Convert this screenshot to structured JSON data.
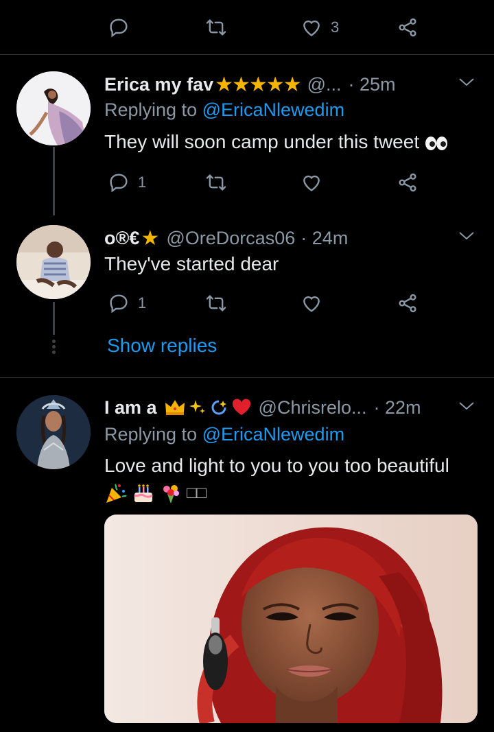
{
  "colors": {
    "background": "#000000",
    "accent": "#1d9bf0",
    "muted": "#8b98a5",
    "text": "#e7e9ea",
    "divider": "#2f3336"
  },
  "top_actions": {
    "like_count": "3"
  },
  "tweets": [
    {
      "display_name": "Erica my fav",
      "name_emoji": "★★★★★",
      "handle": "@...",
      "time": "· 25m",
      "replying_prefix": "Replying to",
      "replying_handle": "@EricaNlewedim",
      "text": "They will soon camp under this tweet",
      "text_emoji": "eyes-icon",
      "reply_count": "1"
    },
    {
      "display_name": "o®€",
      "name_emoji": "★",
      "handle": "@OreDorcas06",
      "time": "· 24m",
      "text": "They've started dear",
      "reply_count": "1"
    },
    {
      "show_replies": "Show replies"
    },
    {
      "display_name": "I am a",
      "name_emoji": "crown sparkles dizzy heart",
      "handle": "@Chrisrelo...",
      "time": "· 22m",
      "replying_prefix": "Replying to",
      "replying_handle": "@EricaNlewedim",
      "text": "Love and light to you to you too beautiful",
      "text_line2_emoji": "party-popper birthday-cake bouquet",
      "text_line2_tail": "□□"
    }
  ]
}
